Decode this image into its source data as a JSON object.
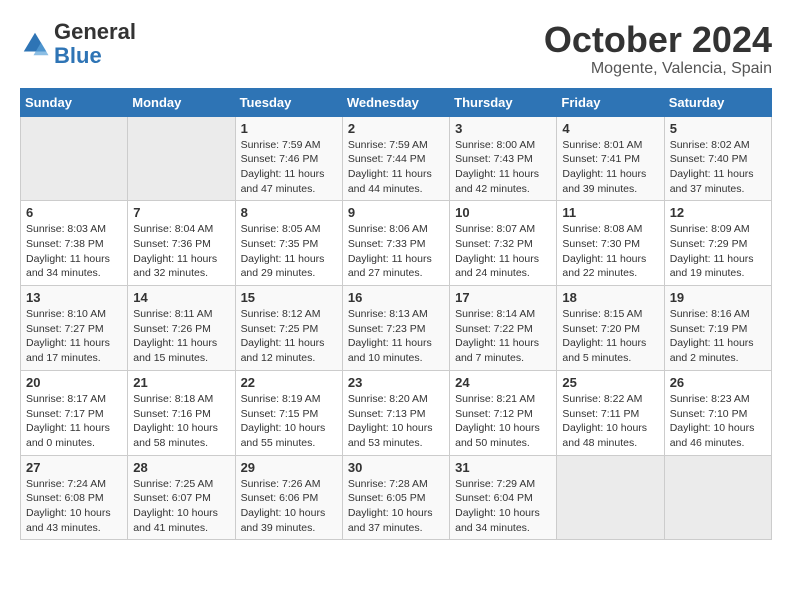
{
  "header": {
    "logo_line1": "General",
    "logo_line2": "Blue",
    "month": "October 2024",
    "location": "Mogente, Valencia, Spain"
  },
  "columns": [
    "Sunday",
    "Monday",
    "Tuesday",
    "Wednesday",
    "Thursday",
    "Friday",
    "Saturday"
  ],
  "weeks": [
    [
      {
        "day": "",
        "info": ""
      },
      {
        "day": "",
        "info": ""
      },
      {
        "day": "1",
        "info": "Sunrise: 7:59 AM\nSunset: 7:46 PM\nDaylight: 11 hours and 47 minutes."
      },
      {
        "day": "2",
        "info": "Sunrise: 7:59 AM\nSunset: 7:44 PM\nDaylight: 11 hours and 44 minutes."
      },
      {
        "day": "3",
        "info": "Sunrise: 8:00 AM\nSunset: 7:43 PM\nDaylight: 11 hours and 42 minutes."
      },
      {
        "day": "4",
        "info": "Sunrise: 8:01 AM\nSunset: 7:41 PM\nDaylight: 11 hours and 39 minutes."
      },
      {
        "day": "5",
        "info": "Sunrise: 8:02 AM\nSunset: 7:40 PM\nDaylight: 11 hours and 37 minutes."
      }
    ],
    [
      {
        "day": "6",
        "info": "Sunrise: 8:03 AM\nSunset: 7:38 PM\nDaylight: 11 hours and 34 minutes."
      },
      {
        "day": "7",
        "info": "Sunrise: 8:04 AM\nSunset: 7:36 PM\nDaylight: 11 hours and 32 minutes."
      },
      {
        "day": "8",
        "info": "Sunrise: 8:05 AM\nSunset: 7:35 PM\nDaylight: 11 hours and 29 minutes."
      },
      {
        "day": "9",
        "info": "Sunrise: 8:06 AM\nSunset: 7:33 PM\nDaylight: 11 hours and 27 minutes."
      },
      {
        "day": "10",
        "info": "Sunrise: 8:07 AM\nSunset: 7:32 PM\nDaylight: 11 hours and 24 minutes."
      },
      {
        "day": "11",
        "info": "Sunrise: 8:08 AM\nSunset: 7:30 PM\nDaylight: 11 hours and 22 minutes."
      },
      {
        "day": "12",
        "info": "Sunrise: 8:09 AM\nSunset: 7:29 PM\nDaylight: 11 hours and 19 minutes."
      }
    ],
    [
      {
        "day": "13",
        "info": "Sunrise: 8:10 AM\nSunset: 7:27 PM\nDaylight: 11 hours and 17 minutes."
      },
      {
        "day": "14",
        "info": "Sunrise: 8:11 AM\nSunset: 7:26 PM\nDaylight: 11 hours and 15 minutes."
      },
      {
        "day": "15",
        "info": "Sunrise: 8:12 AM\nSunset: 7:25 PM\nDaylight: 11 hours and 12 minutes."
      },
      {
        "day": "16",
        "info": "Sunrise: 8:13 AM\nSunset: 7:23 PM\nDaylight: 11 hours and 10 minutes."
      },
      {
        "day": "17",
        "info": "Sunrise: 8:14 AM\nSunset: 7:22 PM\nDaylight: 11 hours and 7 minutes."
      },
      {
        "day": "18",
        "info": "Sunrise: 8:15 AM\nSunset: 7:20 PM\nDaylight: 11 hours and 5 minutes."
      },
      {
        "day": "19",
        "info": "Sunrise: 8:16 AM\nSunset: 7:19 PM\nDaylight: 11 hours and 2 minutes."
      }
    ],
    [
      {
        "day": "20",
        "info": "Sunrise: 8:17 AM\nSunset: 7:17 PM\nDaylight: 11 hours and 0 minutes."
      },
      {
        "day": "21",
        "info": "Sunrise: 8:18 AM\nSunset: 7:16 PM\nDaylight: 10 hours and 58 minutes."
      },
      {
        "day": "22",
        "info": "Sunrise: 8:19 AM\nSunset: 7:15 PM\nDaylight: 10 hours and 55 minutes."
      },
      {
        "day": "23",
        "info": "Sunrise: 8:20 AM\nSunset: 7:13 PM\nDaylight: 10 hours and 53 minutes."
      },
      {
        "day": "24",
        "info": "Sunrise: 8:21 AM\nSunset: 7:12 PM\nDaylight: 10 hours and 50 minutes."
      },
      {
        "day": "25",
        "info": "Sunrise: 8:22 AM\nSunset: 7:11 PM\nDaylight: 10 hours and 48 minutes."
      },
      {
        "day": "26",
        "info": "Sunrise: 8:23 AM\nSunset: 7:10 PM\nDaylight: 10 hours and 46 minutes."
      }
    ],
    [
      {
        "day": "27",
        "info": "Sunrise: 7:24 AM\nSunset: 6:08 PM\nDaylight: 10 hours and 43 minutes."
      },
      {
        "day": "28",
        "info": "Sunrise: 7:25 AM\nSunset: 6:07 PM\nDaylight: 10 hours and 41 minutes."
      },
      {
        "day": "29",
        "info": "Sunrise: 7:26 AM\nSunset: 6:06 PM\nDaylight: 10 hours and 39 minutes."
      },
      {
        "day": "30",
        "info": "Sunrise: 7:28 AM\nSunset: 6:05 PM\nDaylight: 10 hours and 37 minutes."
      },
      {
        "day": "31",
        "info": "Sunrise: 7:29 AM\nSunset: 6:04 PM\nDaylight: 10 hours and 34 minutes."
      },
      {
        "day": "",
        "info": ""
      },
      {
        "day": "",
        "info": ""
      }
    ]
  ]
}
